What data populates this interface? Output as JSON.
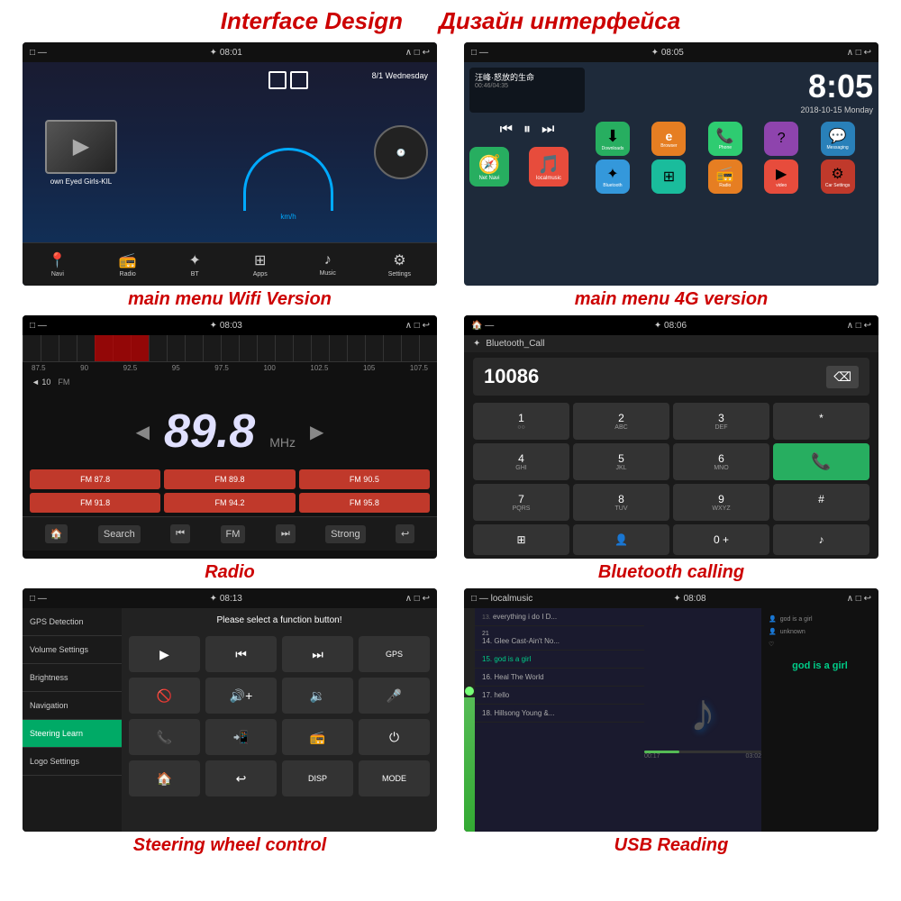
{
  "header": {
    "title_en": "Interface Design",
    "title_ru": "Дизайн интерфейса"
  },
  "screens": [
    {
      "id": "screen1",
      "caption": "main menu Wifi Version",
      "status": "08:01",
      "song": "own Eyed Girls-KIL",
      "date": "8/1 Wednesday",
      "kmh": "km/h",
      "nav_items": [
        "Navi",
        "Radio",
        "BT",
        "Apps",
        "Music",
        "Settings"
      ]
    },
    {
      "id": "screen2",
      "caption": "main menu 4G version",
      "status": "08:05",
      "clock": "8:05",
      "date": "2018-10-15 Monday",
      "song_title": "汪峰·怒放的生命",
      "song_time": "00:46/04:35",
      "apps": [
        {
          "label": "Downloads",
          "color": "#27ae60",
          "icon": "⬇"
        },
        {
          "label": "Browser",
          "color": "#e67e22",
          "icon": "e"
        },
        {
          "label": "Phone",
          "color": "#27ae60",
          "icon": "📞"
        },
        {
          "label": "",
          "color": "#8e44ad",
          "icon": "?"
        },
        {
          "label": "Messaging",
          "color": "#2980b9",
          "icon": "💬"
        },
        {
          "label": "Net Navi",
          "color": "#c0392b",
          "icon": "🧭"
        },
        {
          "label": "localmusic",
          "color": "#e74c3c",
          "icon": "🎵"
        },
        {
          "label": "Bluetooth",
          "color": "#3498db",
          "icon": "✦"
        },
        {
          "label": "",
          "color": "#1abc9c",
          "icon": "⊞"
        },
        {
          "label": "Radio",
          "color": "#e67e22",
          "icon": "📻"
        },
        {
          "label": "",
          "color": "#e74c3c",
          "icon": "▶"
        },
        {
          "label": "Car Settings",
          "color": "#e74c3c",
          "icon": "⚙"
        }
      ]
    },
    {
      "id": "screen3",
      "caption": "Radio",
      "status": "08:03",
      "freq": "89.8",
      "unit": "MHz",
      "freq_labels": [
        "87.5",
        "90",
        "92.5",
        "95",
        "97.5",
        "100",
        "102.5",
        "105",
        "107.5"
      ],
      "presets": [
        "FM 87.8",
        "FM 89.8",
        "FM 90.5",
        "FM 91.8",
        "FM 94.2",
        "FM 95.8"
      ],
      "bottom_btns": [
        "🏠",
        "Search",
        "⏮",
        "FM",
        "⏭",
        "Strong",
        "↩"
      ]
    },
    {
      "id": "screen4",
      "caption": "Bluetooth calling",
      "status": "08:06",
      "title": "Bluetooth_Call",
      "number": "10086",
      "keys": [
        {
          "main": "1",
          "sub": "○○"
        },
        {
          "main": "2",
          "sub": "ABC"
        },
        {
          "main": "3",
          "sub": "DEF"
        },
        {
          "main": "*",
          "sub": ""
        },
        {
          "main": "4",
          "sub": "GHI"
        },
        {
          "main": "5",
          "sub": "JKL"
        },
        {
          "main": "6",
          "sub": "MNO"
        },
        {
          "main": "0 +",
          "sub": ""
        },
        {
          "main": "7",
          "sub": "PQRS"
        },
        {
          "main": "8",
          "sub": "TUV"
        },
        {
          "main": "9",
          "sub": "WXYZ"
        },
        {
          "main": "#",
          "sub": ""
        }
      ]
    },
    {
      "id": "screen5",
      "caption": "Steering wheel control",
      "status": "08:13",
      "instruction": "Please select a function button!",
      "sidebar_items": [
        "GPS Detection",
        "Volume Settings",
        "Brightness",
        "Navigation",
        "Steering Learn",
        "Logo Settings"
      ],
      "active_item": "Steering Learn",
      "button_rows": [
        [
          {
            "icon": "▶",
            "type": "icon"
          },
          {
            "icon": "⏮",
            "type": "icon"
          },
          {
            "icon": "⏭",
            "type": "icon"
          },
          {
            "icon": "GPS",
            "type": "text"
          }
        ],
        [
          {
            "icon": "🚫",
            "type": "icon"
          },
          {
            "icon": "🔊+",
            "type": "icon"
          },
          {
            "icon": "🔊-",
            "type": "icon"
          },
          {
            "icon": "🎤",
            "type": "icon"
          }
        ],
        [
          {
            "icon": "📞",
            "type": "icon"
          },
          {
            "icon": "📲",
            "type": "icon"
          },
          {
            "icon": "📻",
            "type": "icon"
          },
          {
            "icon": "⏻",
            "type": "icon"
          }
        ],
        [
          {
            "icon": "🏠",
            "type": "icon"
          },
          {
            "icon": "↩",
            "type": "icon"
          },
          {
            "icon": "DISP",
            "type": "text"
          },
          {
            "icon": "MODE",
            "type": "text"
          }
        ]
      ]
    },
    {
      "id": "screen6",
      "caption": "USB Reading",
      "status": "08:08",
      "source": "localmusic",
      "tracks": [
        {
          "num": "13.",
          "title": "everything i do I D..."
        },
        {
          "num": "21",
          "title": "14. Glee Cast-Ain't No..."
        },
        {
          "num": "",
          "title": "15. god is a girl",
          "active": true
        },
        {
          "num": "",
          "title": "16. Heal The World"
        },
        {
          "num": "",
          "title": "17. hello"
        },
        {
          "num": "",
          "title": "18. Hillsong Young &..."
        }
      ],
      "right_items": [
        "god is a girl",
        "unknown",
        "♡"
      ],
      "active_song": "god is a girl",
      "time_current": "00:17",
      "time_total": "03:02"
    }
  ]
}
